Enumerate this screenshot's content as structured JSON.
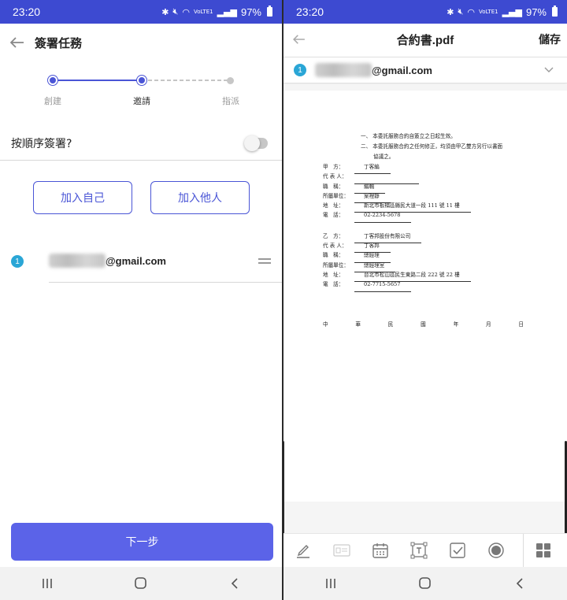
{
  "left": {
    "status": {
      "time": "23:20",
      "signal": "VoLTE1",
      "battery": "97%"
    },
    "appbar": {
      "title": "簽署任務"
    },
    "stepper": {
      "steps": [
        "創建",
        "邀請",
        "指派"
      ]
    },
    "order": {
      "label": "按順序簽署?",
      "enabled": false
    },
    "buttons": {
      "add_self": "加入自己",
      "add_others": "加入他人"
    },
    "signer": {
      "index": "1",
      "email_suffix": "@gmail.com"
    },
    "next": "下一步"
  },
  "right": {
    "status": {
      "time": "23:20",
      "signal": "VoLTE1",
      "battery": "97%"
    },
    "appbar": {
      "title": "合約書.pdf",
      "save": "儲存"
    },
    "signer": {
      "index": "1",
      "email_suffix": "@gmail.com"
    },
    "doc": {
      "clause1": "一、 本委託服務合約自簽立之日起生效。",
      "clause2": "二、 本委託服務合約之任何修正，均須由甲乙雙方另行以書面",
      "clause2b": "協議之。",
      "party_a": [
        {
          "k": "甲　方：",
          "v": "丁客編"
        },
        {
          "k": "代 表 人：",
          "v": ""
        },
        {
          "k": "職　稱：",
          "v": "編輯"
        },
        {
          "k": "所屬單位：",
          "v": "案裡靜"
        },
        {
          "k": "地　址：",
          "v": "新北市板橋區縣民大道一段 111 號 11 樓"
        },
        {
          "k": "電　話：",
          "v": "02-2234-5678"
        }
      ],
      "party_b": [
        {
          "k": "乙　方：",
          "v": "丁客邦股份有限公司"
        },
        {
          "k": "代 表 人：",
          "v": "丁客邦"
        },
        {
          "k": "職　稱：",
          "v": "總經理"
        },
        {
          "k": "所屬單位：",
          "v": "總經理室"
        },
        {
          "k": "地　址：",
          "v": "台北市松山區民生東路二段 222 號 22 樓"
        },
        {
          "k": "電　話：",
          "v": "02-7715-5657"
        }
      ],
      "date": [
        "中",
        "華",
        "民",
        "國",
        "年",
        "月",
        "日"
      ]
    },
    "tools": [
      "signature-tool",
      "stamp-tool",
      "date-tool",
      "text-tool",
      "checkbox-tool",
      "radio-tool",
      "more-tools"
    ]
  },
  "colors": {
    "status_bar": "#3d4ad1",
    "accent": "#4a55d6",
    "primary_button": "#5b63e8",
    "badge": "#2aa6d6"
  }
}
